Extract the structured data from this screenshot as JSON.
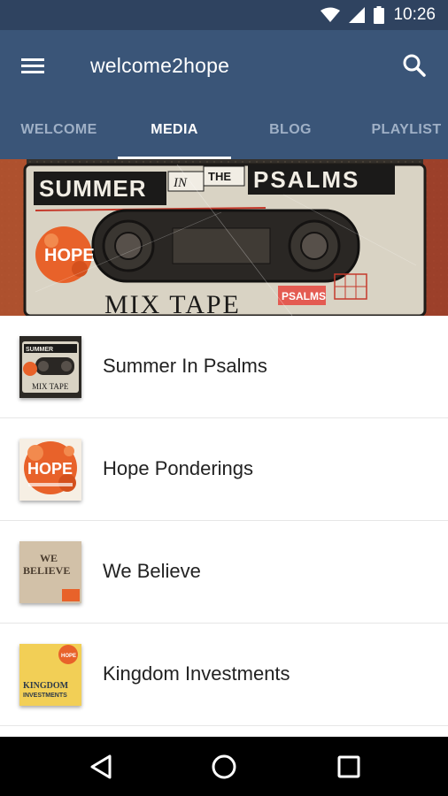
{
  "status_bar": {
    "time": "10:26"
  },
  "app_bar": {
    "title": "welcome2hope"
  },
  "tabs": [
    {
      "label": "WELCOME",
      "active": false
    },
    {
      "label": "MEDIA",
      "active": true
    },
    {
      "label": "BLOG",
      "active": false
    },
    {
      "label": "PLAYLIST",
      "active": false
    }
  ],
  "hero": {
    "title_top": "SUMMER",
    "title_in": "IN",
    "title_the": "THE",
    "title_end": "PSALMS",
    "logo": "HOPE",
    "mix_tape": "MIX TAPE",
    "label_psalms": "PSALMS"
  },
  "media_items": [
    {
      "title": "Summer In Psalms",
      "thumb": "mix-tape"
    },
    {
      "title": "Hope Ponderings",
      "thumb": "hope"
    },
    {
      "title": "We Believe",
      "thumb": "we-believe"
    },
    {
      "title": "Kingdom Investments",
      "thumb": "kingdom"
    }
  ],
  "thumb_text": {
    "mix_top": "SUMMER",
    "mix_bottom": "MIX TAPE",
    "hope": "HOPE",
    "we_believe_1": "WE",
    "we_believe_2": "BELIEVE",
    "kingdom_1": "KINGDOM",
    "kingdom_2": "INVESTMENTS",
    "kingdom_logo": "HOPE"
  },
  "colors": {
    "status_bar": "#2f4360",
    "app_bar": "#3a5578",
    "accent": "#ffffff",
    "hope_orange": "#e8622a"
  }
}
